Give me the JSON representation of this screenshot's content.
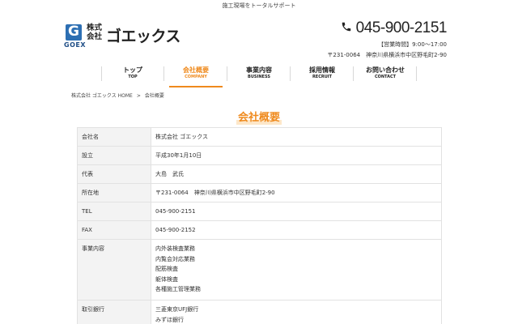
{
  "topbar": {
    "tagline": "施工現場をトータルサポート"
  },
  "logo": {
    "mark_letter": "G",
    "mark_text": "GOEX",
    "kabushiki": "株式会社",
    "company_name": "ゴエックス"
  },
  "contact": {
    "phone_icon": "phone-icon",
    "phone": "045-900-2151",
    "hours": "【営業時間】9:00〜17:00",
    "address": "〒231-0064　神奈川県横浜市中区野毛町2-90"
  },
  "nav": [
    {
      "jp": "トップ",
      "en": "TOP"
    },
    {
      "jp": "会社概要",
      "en": "COMPANY"
    },
    {
      "jp": "事業内容",
      "en": "BUSINESS"
    },
    {
      "jp": "採用情報",
      "en": "RECRUIT"
    },
    {
      "jp": "お問い合わせ",
      "en": "CONTACT"
    }
  ],
  "breadcrumb": {
    "home": "株式会社 ゴエックス HOME",
    "separator": ">",
    "current": "会社概要"
  },
  "page_title": "会社概要",
  "info": [
    {
      "label": "会社名",
      "values": [
        "株式会社 ゴエックス"
      ]
    },
    {
      "label": "設立",
      "values": [
        "平成30年1月10日"
      ]
    },
    {
      "label": "代表",
      "values": [
        "大島　武氏"
      ]
    },
    {
      "label": "所在地",
      "values": [
        "〒231-0064　神奈川県横浜市中区野毛町2-90"
      ]
    },
    {
      "label": "TEL",
      "values": [
        "045-900-2151"
      ]
    },
    {
      "label": "FAX",
      "values": [
        "045-900-2152"
      ]
    },
    {
      "label": "事業内容",
      "values": [
        "内外装検査業務",
        "内覧会対応業務",
        "配筋検査",
        "躯体検査",
        "各種施工管理業務"
      ]
    },
    {
      "label": "取引銀行",
      "values": [
        "三菱東京UFJ銀行",
        "みずほ銀行"
      ]
    }
  ],
  "colors": {
    "accent": "#ef8a1d",
    "logo_blue": "#2d6fb3",
    "label_bg": "#f3f3f3",
    "border": "#e2e2e2"
  }
}
